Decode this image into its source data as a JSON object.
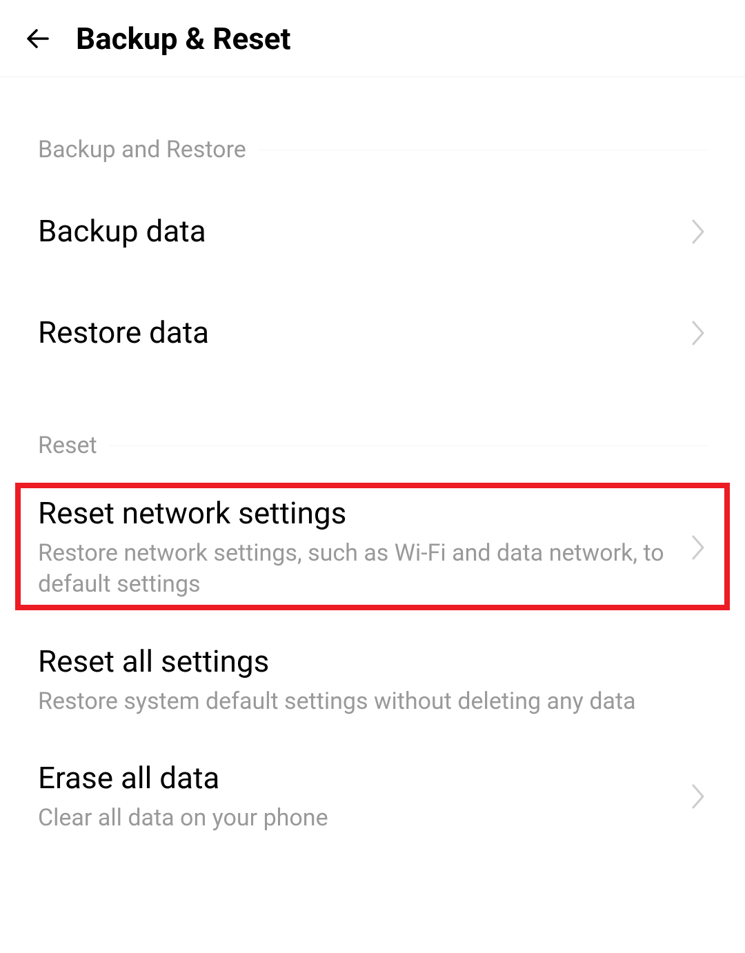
{
  "header": {
    "title": "Backup & Reset"
  },
  "sections": {
    "backup_restore": {
      "title": "Backup and Restore",
      "items": {
        "backup_data": {
          "title": "Backup data"
        },
        "restore_data": {
          "title": "Restore data"
        }
      }
    },
    "reset": {
      "title": "Reset",
      "items": {
        "reset_network": {
          "title": "Reset network settings",
          "subtitle": "Restore network settings, such as Wi-Fi and data network, to default settings"
        },
        "reset_all": {
          "title": "Reset all settings",
          "subtitle": "Restore system default settings without deleting any data"
        },
        "erase_all": {
          "title": "Erase all data",
          "subtitle": "Clear all data on your phone"
        }
      }
    }
  }
}
